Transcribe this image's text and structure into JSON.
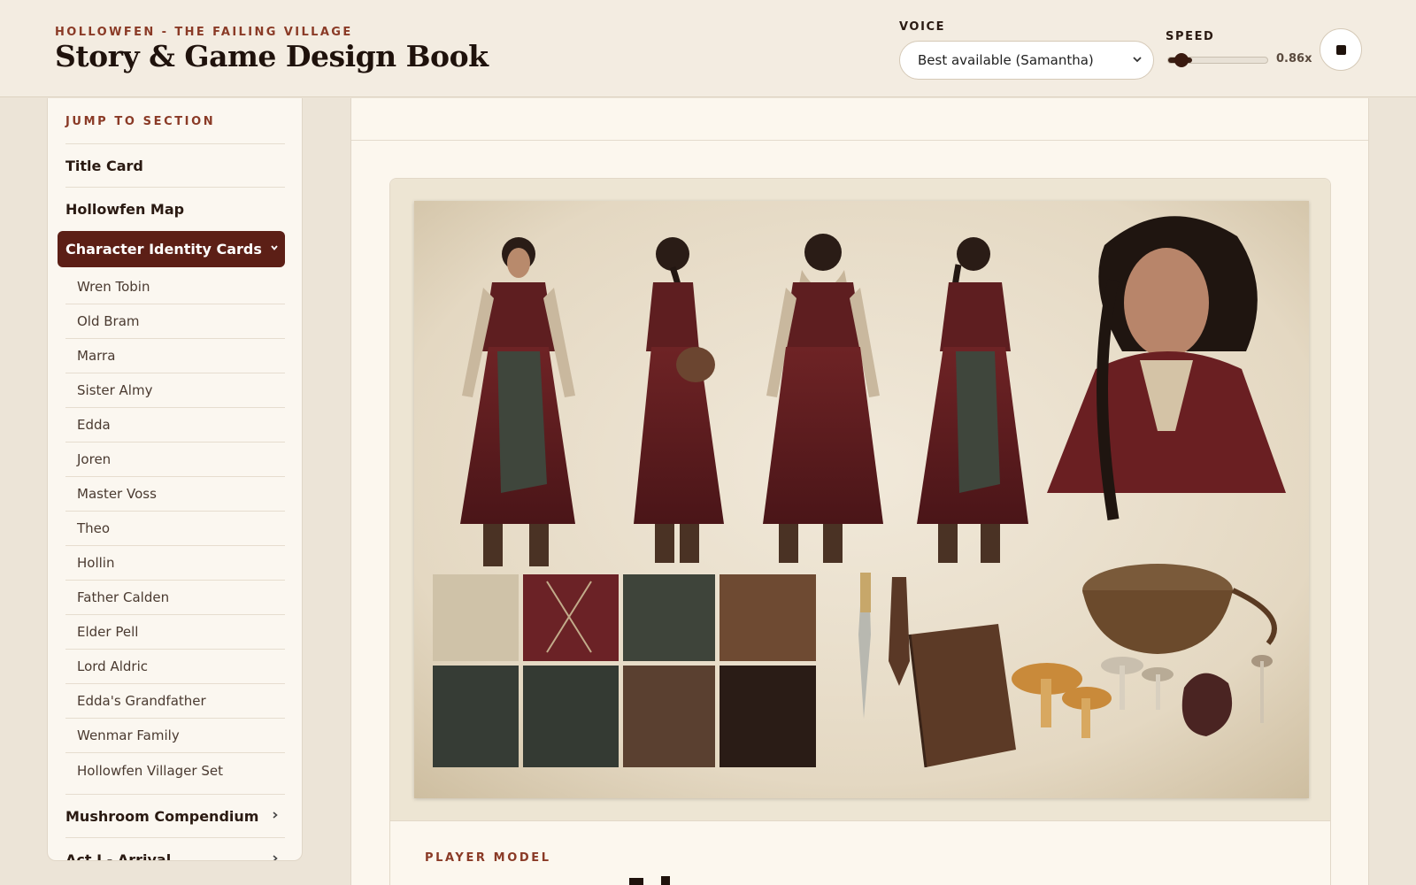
{
  "header": {
    "kicker": "HOLLOWFEN - THE FAILING VILLAGE",
    "title": "Story & Game Design Book",
    "voice_label": "VOICE",
    "voice_value": "Best available (Samantha)",
    "speed_label": "SPEED",
    "speed_value": "0.86x",
    "speed_level": 0.86
  },
  "sidebar": {
    "heading": "JUMP TO SECTION",
    "title_card": "Title Card",
    "map": "Hollowfen Map",
    "active_section": "Character Identity Cards",
    "characters": [
      "Wren Tobin",
      "Old Bram",
      "Marra",
      "Sister Almy",
      "Edda",
      "Joren",
      "Master Voss",
      "Theo",
      "Hollin",
      "Father Calden",
      "Elder Pell",
      "Lord Aldric",
      "Edda's Grandfather",
      "Wenmar Family",
      "Hollowfen Villager Set"
    ],
    "mushroom": "Mushroom Compendium",
    "act1": "Act I - Arrival"
  },
  "main": {
    "section_label": "PLAYER MODEL"
  },
  "icons": {
    "select_chevron": "chevron-down-icon",
    "stop": "stop-icon",
    "expand": "chevron-right-icon",
    "collapse": "chevron-down-icon"
  },
  "colors": {
    "accent": "#8a3a26",
    "active_bg": "#5c1f16",
    "header_bg": "#f3ece1",
    "page_bg": "#ece4d7"
  }
}
